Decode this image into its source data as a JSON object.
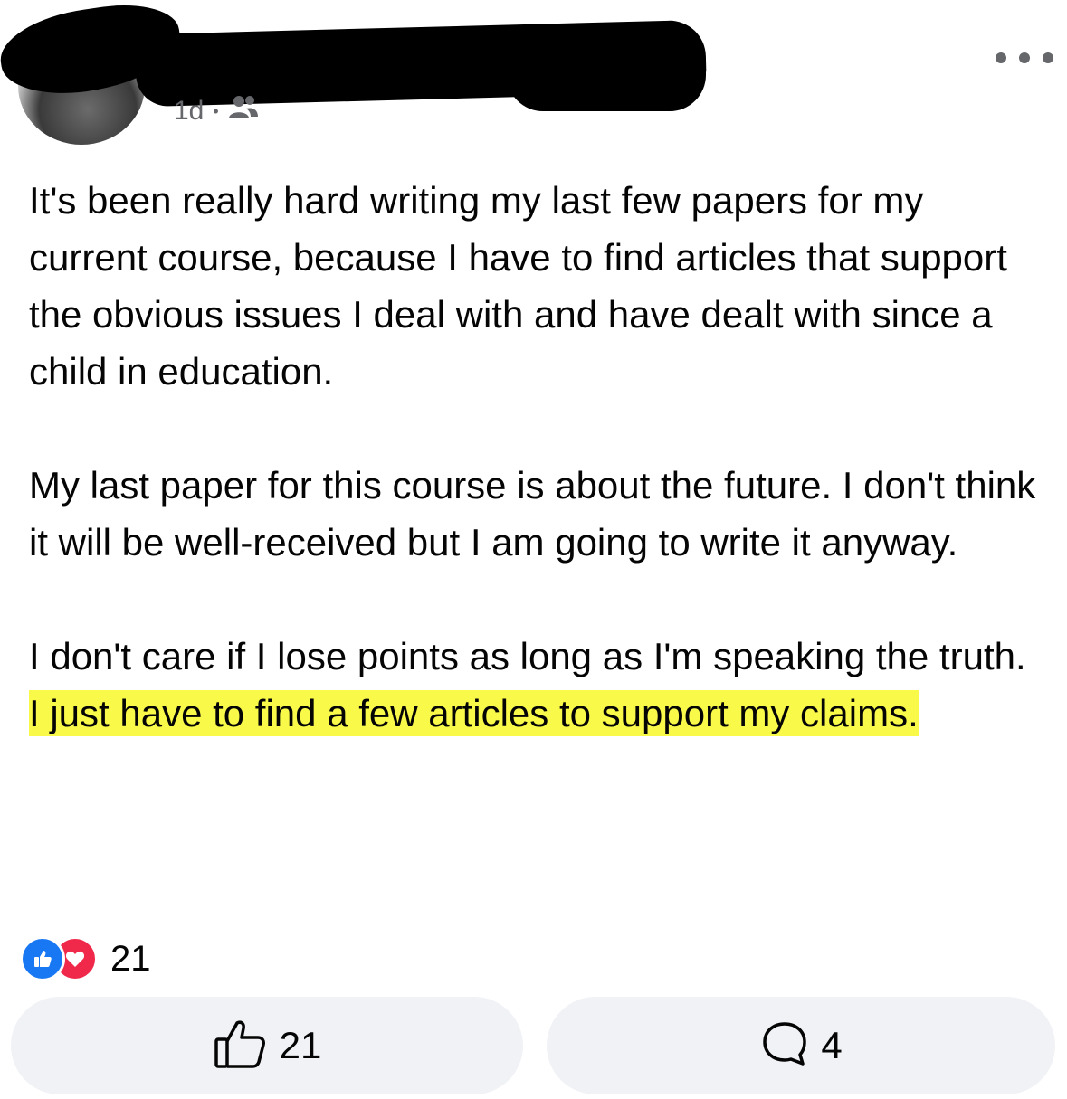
{
  "post": {
    "time": "1d",
    "separator": "•",
    "audience_icon": "friends-icon",
    "more_icon": "more-options-icon",
    "paragraphs": [
      {
        "text": "It's been really hard writing my last few papers for my current course, because I have to find articles that support the obvious issues I deal with and have dealt with since a child in education."
      },
      {
        "text": "My last paper for this course is about the future. I don't think it will be well-received but I am going to write it anyway."
      },
      {
        "text": "I don't care if I lose points as long as I'm speaking the truth.",
        "highlight": " I just have to find a few articles to support my claims."
      }
    ],
    "highlight_color": "#f9f94a"
  },
  "reactions": {
    "icons": [
      "like-icon",
      "love-icon"
    ],
    "count": "21"
  },
  "actions": {
    "like_count": "21",
    "comment_count": "4"
  },
  "colors": {
    "like": "#1877f2",
    "love": "#f02849",
    "button_bg": "#f0f2f5",
    "meta": "#65676b"
  }
}
